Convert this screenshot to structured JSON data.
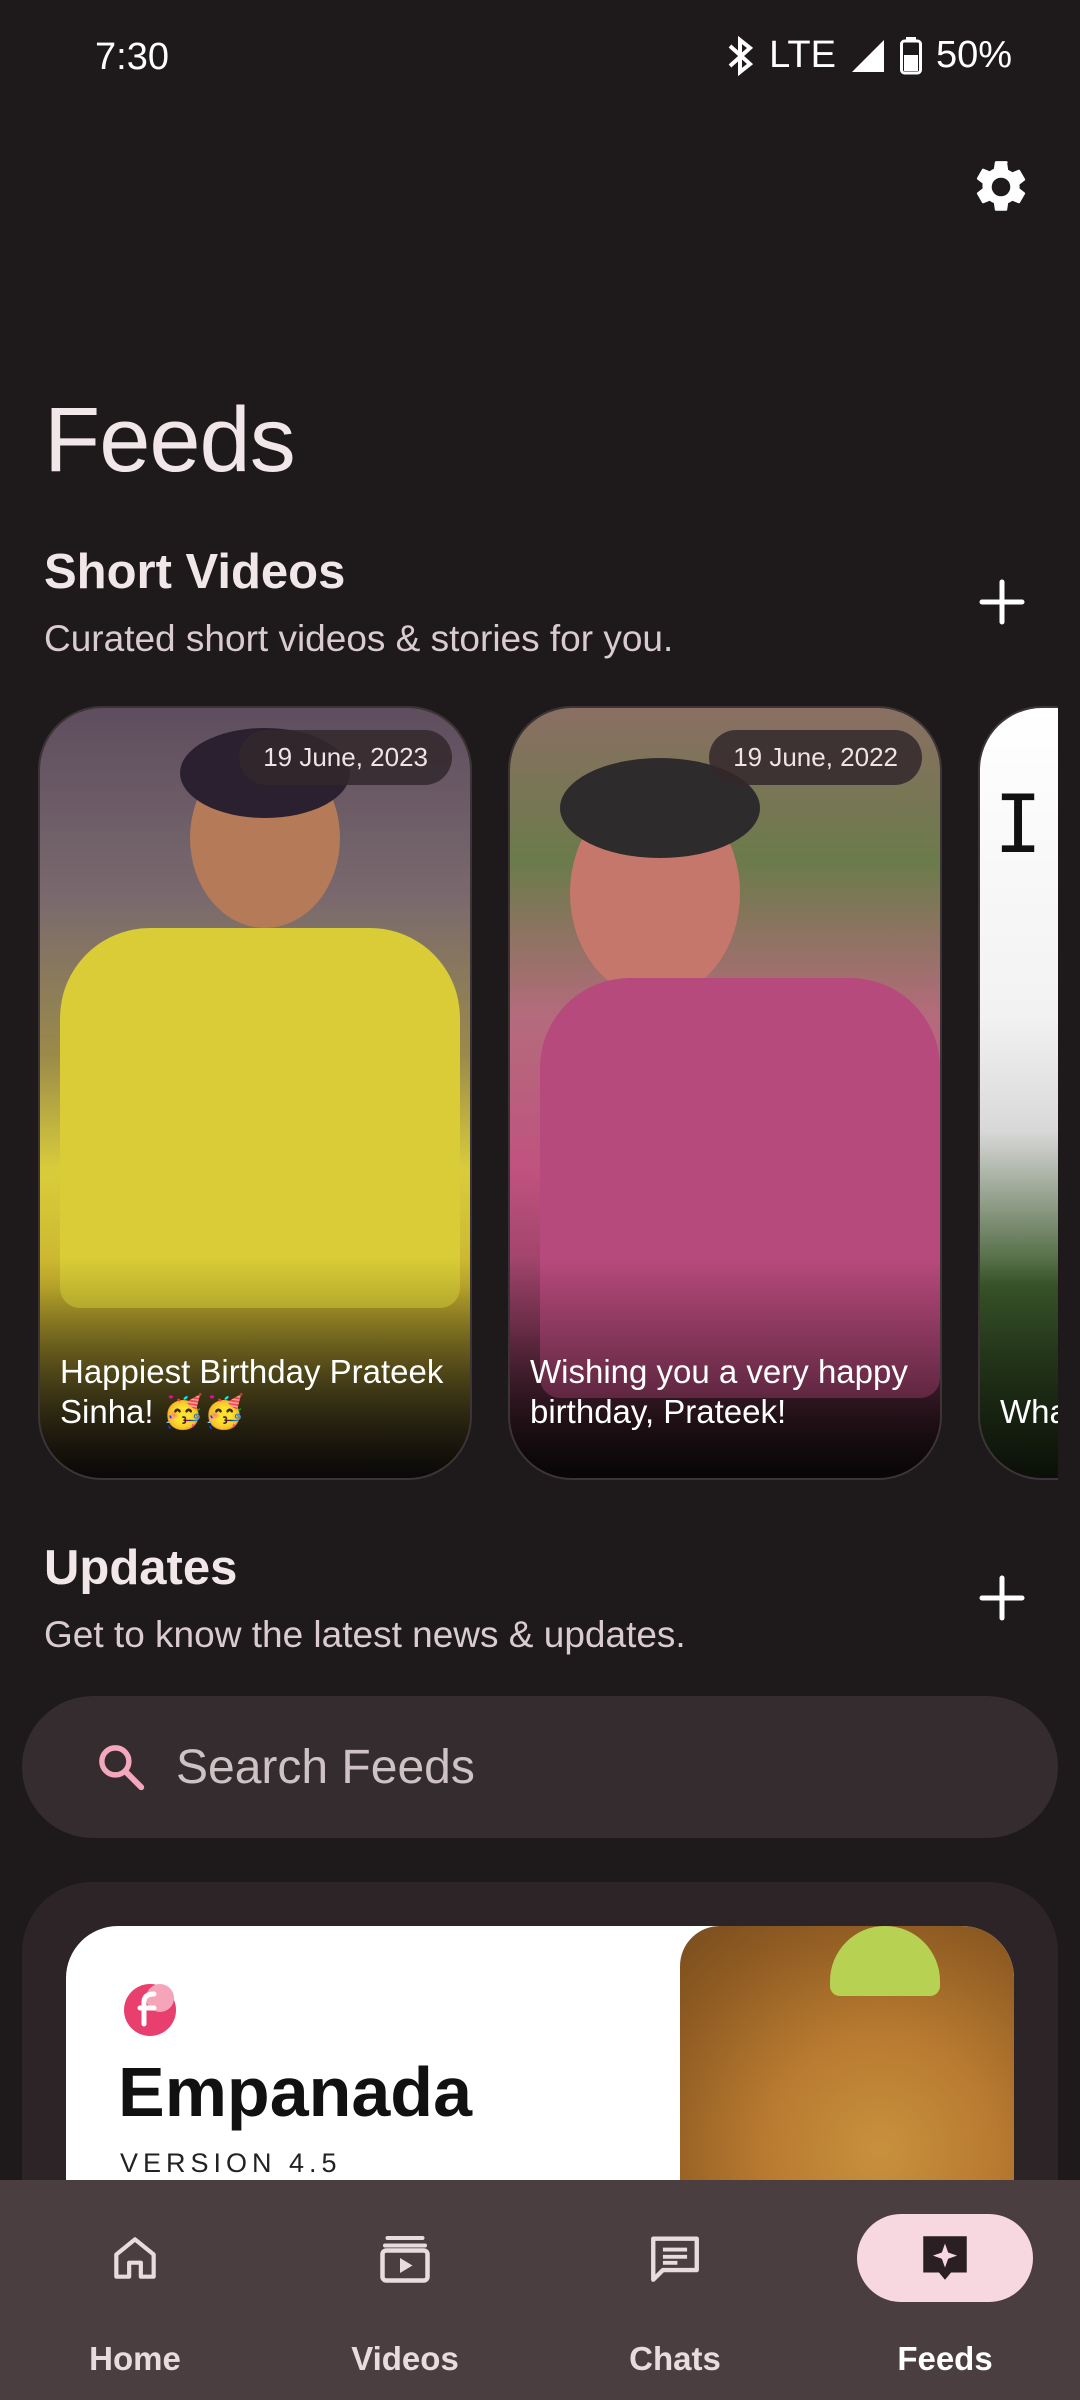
{
  "status_bar": {
    "time": "7:30",
    "network": "LTE",
    "battery": "50%"
  },
  "header": {
    "title": "Feeds",
    "settings_icon": "gear-icon"
  },
  "short_videos": {
    "title": "Short Videos",
    "subtitle": "Curated short videos & stories for you.",
    "add_icon": "plus-icon",
    "cards": [
      {
        "date": "19 June, 2023",
        "caption": "Happiest Birthday Prateek Sinha! 🥳🥳"
      },
      {
        "date": "19 June, 2022",
        "caption": "Wishing you a very happy birthday, Prateek!"
      },
      {
        "date": "",
        "caption": "Wha Fiza",
        "image_text": "I D"
      }
    ]
  },
  "updates": {
    "title": "Updates",
    "subtitle": "Get to know the latest news & updates.",
    "add_icon": "plus-icon"
  },
  "search": {
    "placeholder": "Search Feeds",
    "icon": "search-icon",
    "icon_color": "#f4a8bd"
  },
  "feed_card": {
    "name": "Empanada",
    "version": "VERSION 4.5"
  },
  "bottom_nav": {
    "items": [
      {
        "label": "Home",
        "icon": "home-icon",
        "active": false
      },
      {
        "label": "Videos",
        "icon": "video-library-icon",
        "active": false
      },
      {
        "label": "Chats",
        "icon": "chat-icon",
        "active": false
      },
      {
        "label": "Feeds",
        "icon": "feeds-sparkle-icon",
        "active": true
      }
    ],
    "active_color": "#f7d7e0"
  }
}
